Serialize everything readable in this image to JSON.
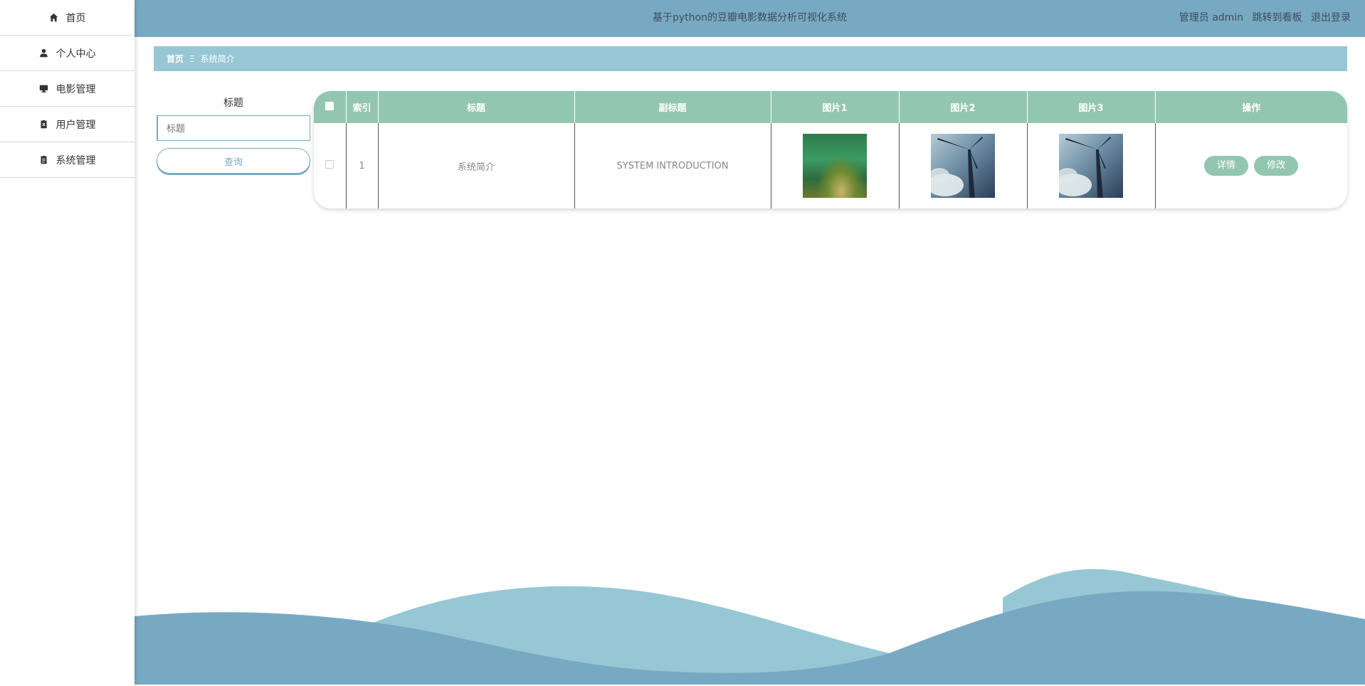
{
  "sidebar": {
    "items": [
      {
        "label": "首页",
        "icon": "home-icon"
      },
      {
        "label": "个人中心",
        "icon": "user-icon"
      },
      {
        "label": "电影管理",
        "icon": "monitor-icon"
      },
      {
        "label": "用户管理",
        "icon": "clipboard-x-icon"
      },
      {
        "label": "系统管理",
        "icon": "clipboard-list-icon"
      }
    ]
  },
  "header": {
    "title": "基于python的豆瓣电影数据分析可视化系统",
    "user_label": "管理员 admin",
    "dashboard_link": "跳转到看板",
    "logout_link": "退出登录"
  },
  "breadcrumb": {
    "home": "首页",
    "separator": "Ξ",
    "current": "系统简介"
  },
  "search": {
    "label": "标题",
    "placeholder": "标题",
    "button": "查询"
  },
  "table": {
    "headers": [
      "索引",
      "标题",
      "副标题",
      "图片1",
      "图片2",
      "图片3",
      "操作"
    ],
    "rows": [
      {
        "index": "1",
        "title": "系统简介",
        "subtitle": "SYSTEM INTRODUCTION",
        "image1": "moss-image",
        "image2": "wind-turbine-image",
        "image3": "wind-turbine-image",
        "actions": {
          "detail": "详情",
          "edit": "修改"
        }
      }
    ]
  },
  "colors": {
    "topbar": "#78a9c3",
    "breadcrumb": "#97c7d5",
    "table_header": "#93c6b0",
    "wave_light": "#97c7d5",
    "wave_dark": "#78a9c3"
  }
}
